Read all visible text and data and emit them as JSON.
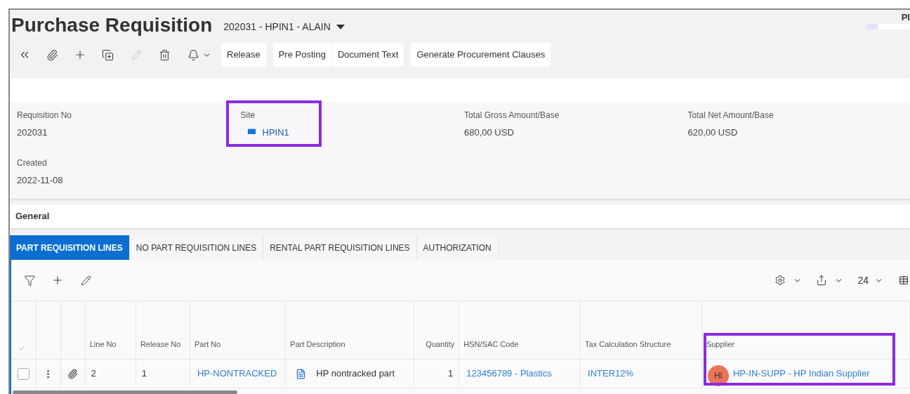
{
  "header": {
    "title": "Purchase Requisition",
    "record": "202031 - HPIN1 - ALAIN",
    "corner_text": "Pl",
    "progress": {
      "level": 0.3
    }
  },
  "toolbar": {
    "button_groups": [
      [
        "Release"
      ],
      [
        "Pre Posting",
        "Document Text"
      ],
      [
        "Generate Procurement Clauses"
      ]
    ]
  },
  "fields": [
    {
      "label": "Requisition No",
      "value": "202031"
    },
    {
      "label": "Site",
      "value": "HPIN1",
      "kind": "site",
      "highlighted": true
    },
    {
      "label": "Total Gross Amount/Base",
      "value": "680,00 USD"
    },
    {
      "label": "Total Net Amount/Base",
      "value": "620,00 USD"
    },
    {
      "label": "Created",
      "value": "2022-11-08"
    }
  ],
  "section": {
    "title": "General"
  },
  "tabs": [
    {
      "label": "PART REQUISITION LINES",
      "selected": true
    },
    {
      "label": "NO PART REQUISITION LINES",
      "selected": false
    },
    {
      "label": "RENTAL PART REQUISITION LINES",
      "selected": false
    },
    {
      "label": "AUTHORIZATION",
      "selected": false
    }
  ],
  "table": {
    "page_size": "24",
    "columns": [
      {
        "label": "Line No"
      },
      {
        "label": "Release No"
      },
      {
        "label": "Part No"
      },
      {
        "label": "Part Description"
      },
      {
        "label": "Quantity",
        "kind": "number"
      },
      {
        "label": "HSN/SAC Code"
      },
      {
        "label": "Tax Calculation Structure"
      },
      {
        "label": "Supplier",
        "highlighted": true
      }
    ],
    "rows": [
      {
        "checked": false,
        "line_no": "2",
        "release_no": "1",
        "part_no": "HP-NONTRACKED",
        "part_description": "HP nontracked part",
        "quantity": "1",
        "hsn_sac_code": "123456789 - Plastics",
        "tax_calculation_structure": "INTER12%",
        "supplier": {
          "initials": "HI",
          "color": "#ee7357",
          "text": "HP-IN-SUPP - HP Indian Supplier"
        }
      }
    ]
  }
}
